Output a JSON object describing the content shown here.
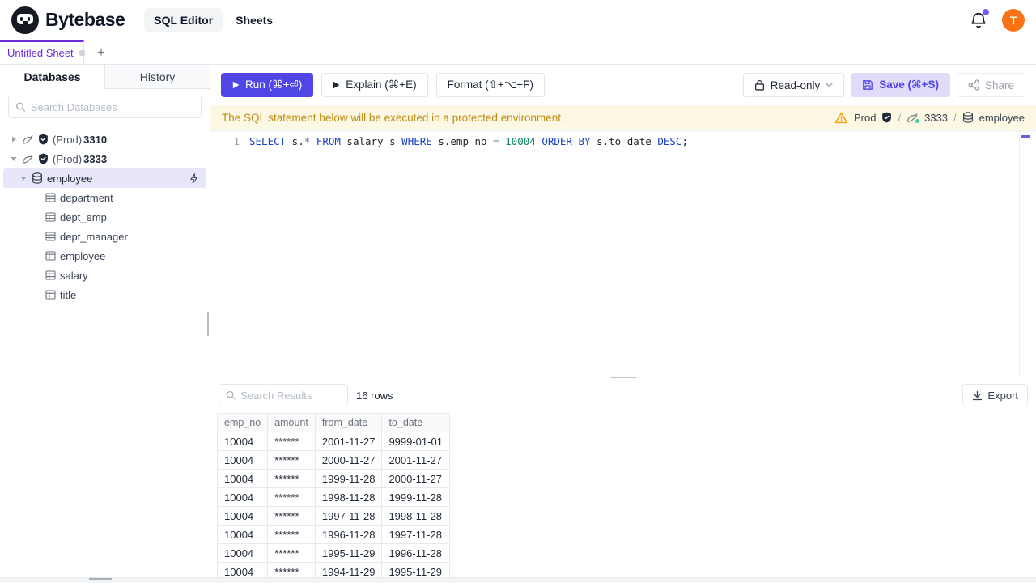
{
  "colors": {
    "accent": "#4f46e5",
    "tab_purple": "#6d28d9",
    "warning_bg": "#fdf8e3",
    "warning_text": "#bd8b13",
    "avatar_orange": "#f97316",
    "selected_row_bg": "#e8e6fb",
    "keyword_blue": "#1a43c8",
    "number_green": "#098658"
  },
  "header": {
    "brand": "Bytebase",
    "nav_sql_editor": "SQL Editor",
    "nav_sheets": "Sheets",
    "avatar_initial": "T"
  },
  "sheet_tabs": {
    "active": "Untitled Sheet",
    "new_tab": "+"
  },
  "sidebar": {
    "tab_databases": "Databases",
    "tab_history": "History",
    "search_placeholder": "Search Databases",
    "instances": [
      {
        "env": "(Prod)",
        "name": "3310"
      },
      {
        "env": "(Prod)",
        "name": "3333"
      }
    ],
    "database": "employee",
    "tables": [
      "department",
      "dept_emp",
      "dept_manager",
      "employee",
      "salary",
      "title"
    ]
  },
  "toolbar": {
    "run": "Run (⌘+⏎)",
    "explain": "Explain (⌘+E)",
    "format": "Format (⇧+⌥+F)",
    "readonly": "Read-only",
    "save": "Save (⌘+S)",
    "share": "Share"
  },
  "banner": {
    "message": "The SQL statement below will be executed in a protected environment.",
    "environment": "Prod",
    "separator": "/",
    "instance": "3333",
    "database": "employee"
  },
  "editor": {
    "line_number": "1",
    "tokens": [
      {
        "text": "SELECT"
      },
      {
        "text": " s."
      },
      {
        "text": "*"
      },
      {
        "text": " "
      },
      {
        "text": "FROM"
      },
      {
        "text": " salary s "
      },
      {
        "text": "WHERE"
      },
      {
        "text": " s.emp_no "
      },
      {
        "text": "="
      },
      {
        "text": " "
      },
      {
        "text": "10004"
      },
      {
        "text": " "
      },
      {
        "text": "ORDER"
      },
      {
        "text": " "
      },
      {
        "text": "BY"
      },
      {
        "text": " s.to_date "
      },
      {
        "text": "DESC"
      },
      {
        "text": ";"
      }
    ]
  },
  "results": {
    "search_placeholder": "Search Results",
    "row_count": "16 rows",
    "export_label": "Export",
    "columns": [
      "emp_no",
      "amount",
      "from_date",
      "to_date"
    ],
    "rows": [
      [
        "10004",
        "******",
        "2001-11-27",
        "9999-01-01"
      ],
      [
        "10004",
        "******",
        "2000-11-27",
        "2001-11-27"
      ],
      [
        "10004",
        "******",
        "1999-11-28",
        "2000-11-27"
      ],
      [
        "10004",
        "******",
        "1998-11-28",
        "1999-11-28"
      ],
      [
        "10004",
        "******",
        "1997-11-28",
        "1998-11-28"
      ],
      [
        "10004",
        "******",
        "1996-11-28",
        "1997-11-28"
      ],
      [
        "10004",
        "******",
        "1995-11-29",
        "1996-11-28"
      ],
      [
        "10004",
        "******",
        "1994-11-29",
        "1995-11-29"
      ]
    ]
  }
}
